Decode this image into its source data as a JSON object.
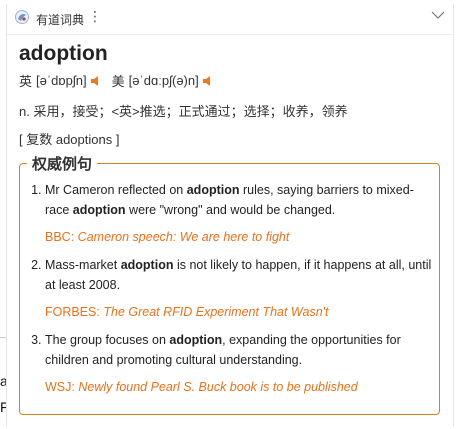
{
  "app": {
    "name": "有道词典"
  },
  "entry": {
    "headword": "adoption",
    "phonetics": [
      {
        "label": "英",
        "ipa": "[əˈdɒpʃn]"
      },
      {
        "label": "美",
        "ipa": "[əˈdɑːpʃ(ə)n]"
      }
    ],
    "definition": "n. 采用，接受；<英>推选；正式通过；选择；收养，领养",
    "plural": "[ 复数 adoptions ]"
  },
  "authoritative": {
    "title": "权威例句",
    "examples": [
      {
        "before": "Mr Cameron reflected on ",
        "kw1": "adoption",
        "middle": " rules, saying barriers to mixed-race ",
        "kw2": "adoption",
        "after": " were \"wrong\" and would be changed.",
        "source": "BBC:",
        "source_title": "Cameron speech: We are here to fight"
      },
      {
        "before": "Mass-market ",
        "kw1": "adoption",
        "middle": " is not likely to happen, if it happens at all, until at least 2008.",
        "source": "FORBES:",
        "source_title": "The Great RFID Experiment That Wasn't"
      },
      {
        "before": "The group focuses on ",
        "kw1": "adoption",
        "middle": ", expanding the opportunities for children and promoting cultural understanding.",
        "source": "WSJ:",
        "source_title": "Newly found Pearl S. Buck book is to be published"
      }
    ]
  },
  "background": {
    "frag1": "a",
    "frag2": "F"
  },
  "colors": {
    "accent": "#e8711a",
    "border": "#d8821f"
  },
  "icons": [
    "youdao-logo-icon",
    "kebab-menu-icon",
    "chevron-down-icon",
    "speaker-icon"
  ]
}
